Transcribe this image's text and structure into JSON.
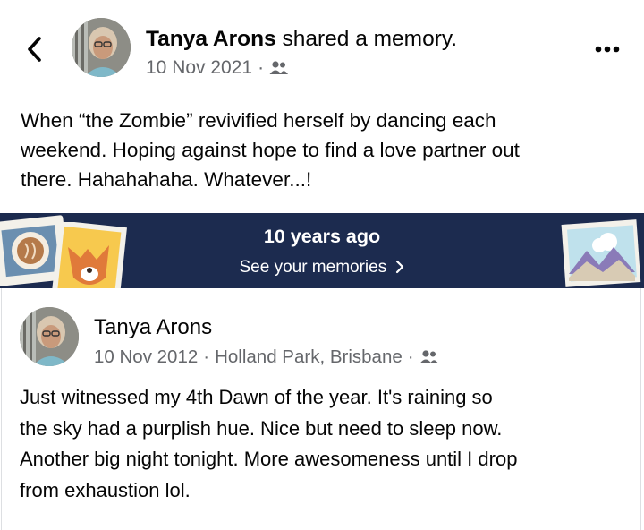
{
  "header": {
    "back_icon": "chevron-left-icon",
    "author": "Tanya Arons",
    "action": " shared a memory.",
    "date": "10 Nov 2021",
    "separator": "·",
    "audience_icon": "friends-icon",
    "more_icon": "more-horizontal-icon"
  },
  "share_text": [
    "When “the Zombie” revivified herself by dancing each",
    "weekend.  Hoping against hope to find a love partner out",
    "there.  Hahahahaha.  Whatever...!"
  ],
  "memory_banner": {
    "title": "10 years ago",
    "link": "See your memories",
    "link_icon": "chevron-right-icon",
    "background": "#1c2b4f"
  },
  "original_post": {
    "author": "Tanya Arons",
    "date": "10 Nov 2012",
    "separator": "·",
    "location": "Holland Park, Brisbane",
    "separator2": "·",
    "audience_icon": "friends-icon",
    "text": [
      "Just witnessed my 4th Dawn of the year.  It's raining so",
      "the sky had a purplish hue.  Nice but need to sleep now.",
      "Another big night tonight.  More awesomeness until I drop",
      "from exhaustion lol."
    ]
  }
}
